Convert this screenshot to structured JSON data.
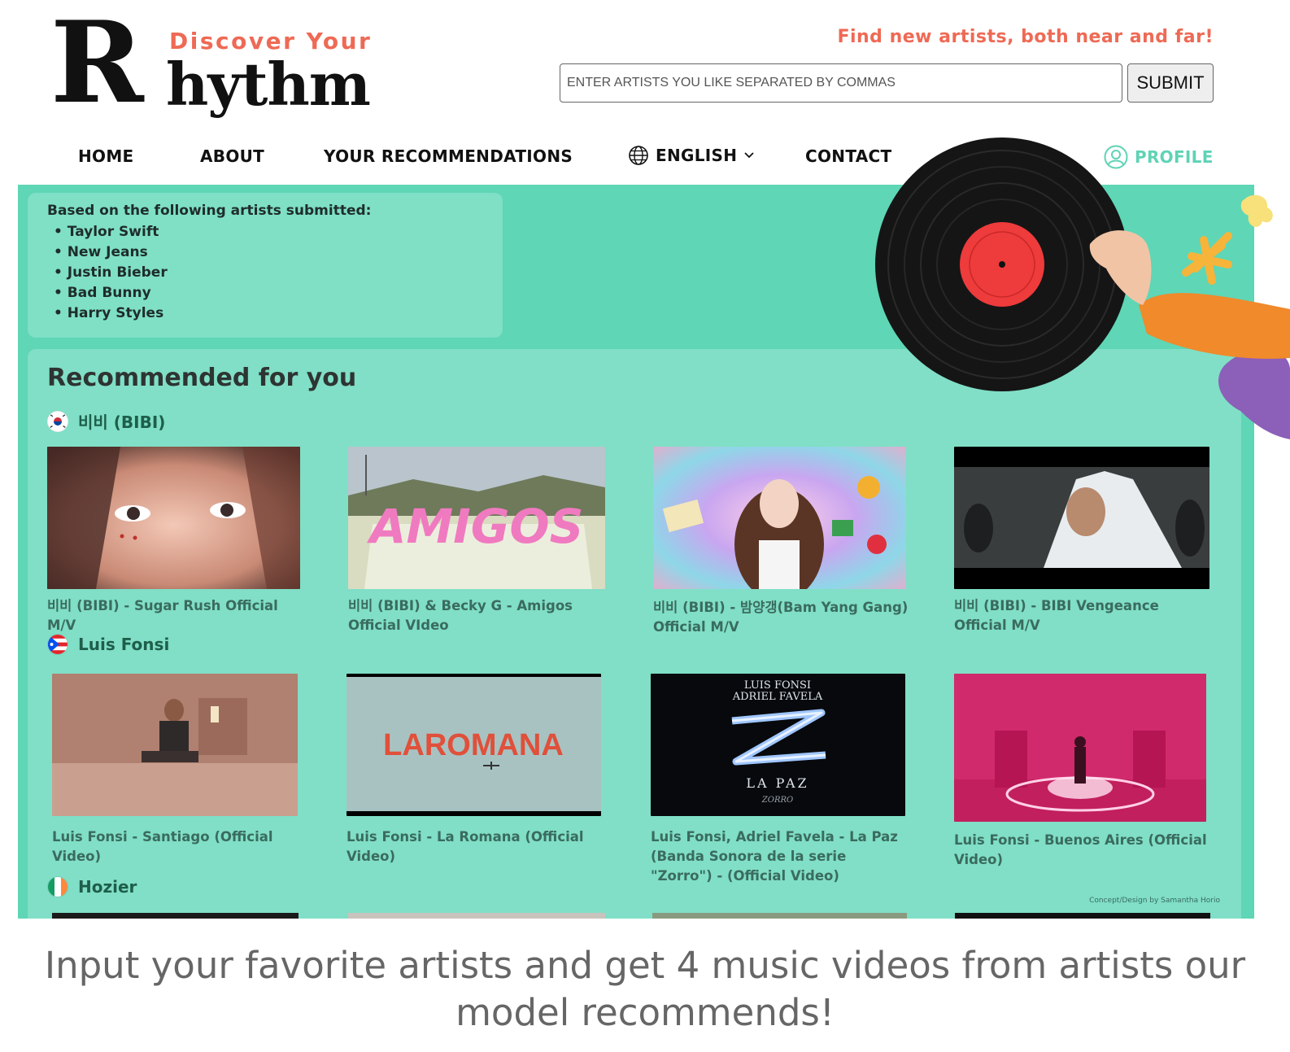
{
  "header": {
    "logo_top": "Discover Your",
    "logo_initial": "R",
    "logo_rest": "hythm",
    "tagline": "Find new artists, both near and far!",
    "search_placeholder": "ENTER ARTISTS YOU LIKE SEPARATED BY COMMAS",
    "submit_label": "SUBMIT"
  },
  "nav": {
    "home": "HOME",
    "about": "ABOUT",
    "recommendations": "YOUR RECOMMENDATIONS",
    "language": "ENGLISH",
    "contact": "CONTACT",
    "profile": "PROFILE"
  },
  "submitted": {
    "title": "Based on the following artists submitted:",
    "artists": [
      "Taylor Swift",
      "New Jeans",
      "Justin Bieber",
      "Bad Bunny",
      "Harry Styles"
    ]
  },
  "recommended": {
    "title": "Recommended for you",
    "groups": [
      {
        "artist": "비비 (BIBI)",
        "flag": "south-korea",
        "videos": [
          "비비 (BIBI) - Sugar Rush Official M/V",
          "비비 (BIBI) & Becky G - Amigos Official VIdeo",
          "비비 (BIBI) - 밤양갱(Bam Yang Gang) Official M/V",
          "비비 (BIBI) - BIBI Vengeance Official M/V"
        ]
      },
      {
        "artist": "Luis Fonsi",
        "flag": "puerto-rico",
        "videos": [
          "Luis Fonsi - Santiago (Official Video)",
          "Luis Fonsi - La Romana (Official Video)",
          "Luis Fonsi, Adriel Favela - La Paz (Banda Sonora de la serie \"Zorro\") - (Official Video)",
          "Luis Fonsi - Buenos Aires (Official Video)"
        ]
      },
      {
        "artist": "Hozier",
        "flag": "ireland",
        "videos": []
      }
    ],
    "thumb_text": {
      "amigos": "AMIGOS",
      "la_romana": "LAROMANA",
      "zorro_top": "LUIS FONSI",
      "zorro_top2": "ADRIEL FAVELA",
      "zorro_bottom": "LA PAZ",
      "zorro_logo": "ZORRO"
    },
    "credit": "Concept/Design by Samantha Horio"
  },
  "colors": {
    "accent": "#ee6a55",
    "panel": "#5fd6b6",
    "card": "#80dfc6",
    "profile": "#5fd3b6"
  },
  "caption": "Input your favorite artists and get 4 music videos from artists our model recommends!"
}
